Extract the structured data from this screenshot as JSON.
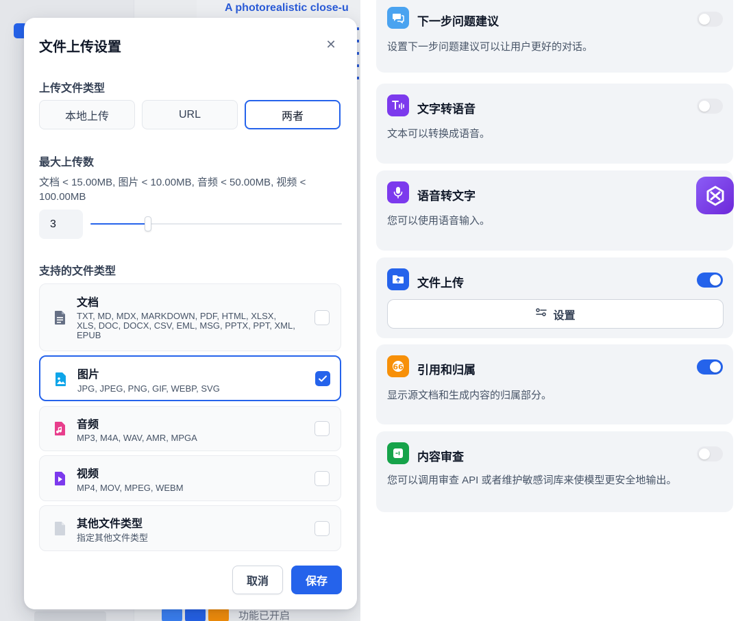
{
  "background": {
    "prompt_text": "A photorealistic close-u",
    "status_text": "功能已开启"
  },
  "modal": {
    "title": "文件上传设置",
    "upload_type": {
      "label": "上传文件类型",
      "options": [
        "本地上传",
        "URL",
        "两者"
      ],
      "selected": "两者"
    },
    "max_uploads": {
      "label": "最大上传数",
      "limits_text": "文档 < 15.00MB, 图片 < 10.00MB, 音频 < 50.00MB, 视频 < 100.00MB",
      "value": "3",
      "slider_fraction": 0.23
    },
    "file_types": {
      "label": "支持的文件类型",
      "items": [
        {
          "name": "文档",
          "exts": "TXT, MD, MDX, MARKDOWN, PDF, HTML, XLSX, XLS, DOC, DOCX, CSV, EML, MSG, PPTX, PPT, XML, EPUB",
          "checked": false,
          "icon": "document-icon"
        },
        {
          "name": "图片",
          "exts": "JPG, JPEG, PNG, GIF, WEBP, SVG",
          "checked": true,
          "icon": "image-icon"
        },
        {
          "name": "音频",
          "exts": "MP3, M4A, WAV, AMR, MPGA",
          "checked": false,
          "icon": "audio-icon"
        },
        {
          "name": "视频",
          "exts": "MP4, MOV, MPEG, WEBM",
          "checked": false,
          "icon": "video-icon"
        },
        {
          "name": "其他文件类型",
          "exts": "指定其他文件类型",
          "checked": false,
          "icon": "other-file-icon"
        }
      ]
    },
    "buttons": {
      "cancel": "取消",
      "save": "保存"
    }
  },
  "features": {
    "items": [
      {
        "title": "下一步问题建议",
        "desc": "设置下一步问题建议可以让用户更好的对话。",
        "enabled": false,
        "icon": "chat-suggest-icon",
        "color": "#4aa3f0"
      },
      {
        "title": "文字转语音",
        "desc": "文本可以转换成语音。",
        "enabled": false,
        "icon": "text-to-speech-icon",
        "color": "#7c3aed"
      },
      {
        "title": "语音转文字",
        "desc": "您可以使用语音输入。",
        "enabled": false,
        "icon": "microphone-icon",
        "color": "#7c3aed"
      },
      {
        "title": "文件上传",
        "desc": "",
        "enabled": true,
        "icon": "file-upload-icon",
        "color": "#2563eb",
        "settings_label": "设置"
      },
      {
        "title": "引用和归属",
        "desc": "显示源文档和生成内容的归属部分。",
        "enabled": true,
        "icon": "quote-icon",
        "color": "#f79009"
      },
      {
        "title": "内容审查",
        "desc": "您可以调用审查 API 或者维护敏感词库来使模型更安全地输出。",
        "enabled": false,
        "icon": "moderation-icon",
        "color": "#16a34a"
      }
    ]
  },
  "colors": {
    "accent": "#2563eb",
    "toggle_off": "#e9eaee",
    "card_bg": "#f2f4f7"
  }
}
